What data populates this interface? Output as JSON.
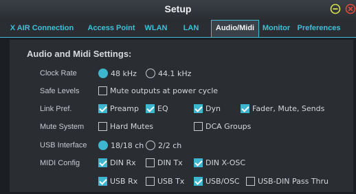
{
  "window": {
    "title": "Setup",
    "minimize_icon": "minus-circle-icon",
    "close_icon": "x-circle-icon"
  },
  "tabs": [
    {
      "label": "X AIR Connection",
      "active": false
    },
    {
      "label": "Access Point",
      "active": false
    },
    {
      "label": "WLAN",
      "active": false
    },
    {
      "label": "LAN",
      "active": false
    },
    {
      "label": "Audio/Midi",
      "active": true
    },
    {
      "label": "Monitor",
      "active": false
    },
    {
      "label": "Preferences",
      "active": false
    }
  ],
  "section": {
    "title": "Audio and Midi Settings:"
  },
  "settings": {
    "clock_rate": {
      "label": "Clock Rate",
      "options": [
        {
          "text": "48 kHz",
          "checked": true
        },
        {
          "text": "44.1 kHz",
          "checked": false
        }
      ]
    },
    "safe_levels": {
      "label": "Safe Levels",
      "options": [
        {
          "text": "Mute outputs at power cycle",
          "checked": false
        }
      ]
    },
    "link_pref": {
      "label": "Link Pref.",
      "options": [
        {
          "text": "Preamp",
          "checked": true
        },
        {
          "text": "EQ",
          "checked": true
        },
        {
          "text": "Dyn",
          "checked": true
        },
        {
          "text": "Fader, Mute, Sends",
          "checked": true
        }
      ]
    },
    "mute_system": {
      "label": "Mute System",
      "options": [
        {
          "text": "Hard Mutes",
          "checked": false
        },
        {
          "text": "DCA Groups",
          "checked": false
        }
      ]
    },
    "usb_interface": {
      "label": "USB Interface",
      "options": [
        {
          "text": "18/18 ch",
          "checked": true
        },
        {
          "text": "2/2 ch",
          "checked": false
        }
      ]
    },
    "midi_config": {
      "label": "MIDI Config",
      "row1": [
        {
          "text": "DIN Rx",
          "checked": true
        },
        {
          "text": "DIN Tx",
          "checked": false
        },
        {
          "text": "DIN X-OSC",
          "checked": true
        }
      ],
      "row2": [
        {
          "text": "USB Rx",
          "checked": true
        },
        {
          "text": "USB Tx",
          "checked": false
        },
        {
          "text": "USB/OSC",
          "checked": true
        },
        {
          "text": "USB-DIN Pass Thru",
          "checked": false
        }
      ]
    }
  },
  "colors": {
    "accent": "#3fc0d8",
    "checked_fill": "#3fb6cf",
    "background": "#1b1e22",
    "panel": "#2a2e33"
  }
}
